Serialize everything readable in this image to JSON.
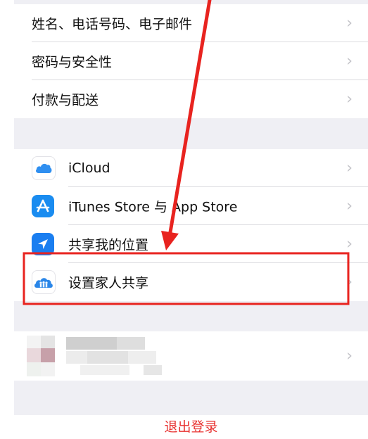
{
  "account_group": {
    "items": [
      {
        "label": "姓名、电话号码、电子邮件"
      },
      {
        "label": "密码与安全性"
      },
      {
        "label": "付款与配送"
      }
    ]
  },
  "services_group": {
    "items": [
      {
        "label": "iCloud",
        "icon": "icloud-icon"
      },
      {
        "label": "iTunes Store 与 App Store",
        "icon": "app-store-icon"
      },
      {
        "label": "共享我的位置",
        "icon": "location-arrow-icon"
      },
      {
        "label": "设置家人共享",
        "icon": "family-sharing-icon"
      }
    ]
  },
  "sign_out": {
    "label": "退出登录"
  },
  "chevron": "›",
  "colors": {
    "background": "#efeff4",
    "sign_out": "#e8312f",
    "annotation": "#e8231f",
    "app_store_blue": "#1a8cf0"
  }
}
